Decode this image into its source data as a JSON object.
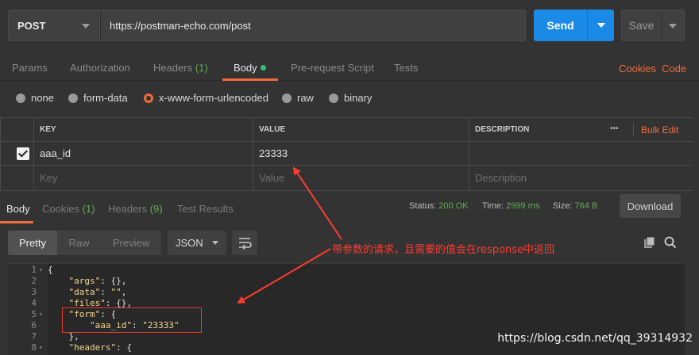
{
  "request": {
    "method": "POST",
    "url": "https://postman-echo.com/post",
    "send_label": "Send",
    "save_label": "Save"
  },
  "request_tabs": {
    "params": "Params",
    "authorization": "Authorization",
    "headers": "Headers",
    "headers_count": "(1)",
    "body": "Body",
    "prerequest": "Pre-request Script",
    "tests": "Tests",
    "cookies": "Cookies",
    "code": "Code"
  },
  "body_modes": {
    "none": "none",
    "form_data": "form-data",
    "urlencoded": "x-www-form-urlencoded",
    "raw": "raw",
    "binary": "binary",
    "selected": "x-www-form-urlencoded"
  },
  "kv_table": {
    "headers": {
      "key": "KEY",
      "value": "VALUE",
      "description": "DESCRIPTION",
      "more": "•••",
      "bulk_edit": "Bulk Edit"
    },
    "rows": [
      {
        "checked": true,
        "key": "aaa_id",
        "value": "23333",
        "description": ""
      }
    ],
    "placeholders": {
      "key": "Key",
      "value": "Value",
      "description": "Description"
    }
  },
  "response_tabs": {
    "body": "Body",
    "cookies": "Cookies",
    "cookies_count": "(1)",
    "headers": "Headers",
    "headers_count": "(9)",
    "test_results": "Test Results"
  },
  "response_meta": {
    "status_label": "Status:",
    "status_value": "200 OK",
    "time_label": "Time:",
    "time_value": "2999 ms",
    "size_label": "Size:",
    "size_value": "764 B",
    "download_label": "Download"
  },
  "view_modes": {
    "pretty": "Pretty",
    "raw": "Raw",
    "preview": "Preview",
    "format": "JSON"
  },
  "code_lines": [
    {
      "n": "1",
      "fold": true,
      "indent": "",
      "parts": [
        [
          "{",
          "k"
        ]
      ]
    },
    {
      "n": "2",
      "fold": false,
      "indent": "    ",
      "parts": [
        [
          "\"args\"",
          "s"
        ],
        [
          ": {},",
          "k"
        ]
      ]
    },
    {
      "n": "3",
      "fold": false,
      "indent": "    ",
      "parts": [
        [
          "\"data\"",
          "s"
        ],
        [
          ": ",
          "k"
        ],
        [
          "\"\"",
          "s"
        ],
        [
          ",",
          "k"
        ]
      ]
    },
    {
      "n": "4",
      "fold": false,
      "indent": "    ",
      "parts": [
        [
          "\"files\"",
          "s"
        ],
        [
          ": {},",
          "k"
        ]
      ]
    },
    {
      "n": "5",
      "fold": true,
      "indent": "    ",
      "parts": [
        [
          "\"form\"",
          "s"
        ],
        [
          ": {",
          "k"
        ]
      ]
    },
    {
      "n": "6",
      "fold": false,
      "indent": "        ",
      "parts": [
        [
          "\"aaa_id\"",
          "s"
        ],
        [
          ": ",
          "k"
        ],
        [
          "\"23333\"",
          "s"
        ]
      ]
    },
    {
      "n": "7",
      "fold": false,
      "indent": "    ",
      "parts": [
        [
          "},",
          "k"
        ]
      ]
    },
    {
      "n": "8",
      "fold": true,
      "indent": "    ",
      "parts": [
        [
          "\"headers\"",
          "s"
        ],
        [
          ": {",
          "k"
        ]
      ]
    }
  ],
  "annotation": {
    "text": "带参数的请求，且需要的值会在response中返回",
    "color": "#ff3b30"
  },
  "watermark": "https://blog.csdn.net/qq_39314932",
  "colors": {
    "accent": "#f26b3a",
    "send": "#1b8ae6",
    "ok": "#5fae4f"
  }
}
